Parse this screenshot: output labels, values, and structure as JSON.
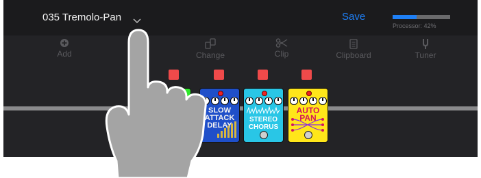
{
  "header": {
    "preset_name": "035 Tremolo-Pan",
    "save_label": "Save",
    "processor_label": "Processor: 42%",
    "processor_fraction": 0.42,
    "accent": "#1e7ff5"
  },
  "toolbar": {
    "items": [
      {
        "label": "Add",
        "icon": "plus-circle-icon"
      },
      {
        "label": "",
        "icon": "obscured-tool-icon"
      },
      {
        "label": "Change",
        "icon": "swap-icon"
      },
      {
        "label": "Clip",
        "icon": "scissors-icon"
      },
      {
        "label": "Clipboard",
        "icon": "clipboard-icon"
      },
      {
        "label": "Tuner",
        "icon": "tuning-fork-icon"
      }
    ]
  },
  "pedals": [
    {
      "name": "green-pedal",
      "title": "",
      "color": "#2ee82a"
    },
    {
      "name": "slow-attack-delay",
      "title": "SLOW ATTACK DELAY",
      "color": "#1f4fc9"
    },
    {
      "name": "stereo-chorus",
      "title": "STEREO CHORUS",
      "color": "#29c6e6"
    },
    {
      "name": "auto-pan",
      "title": "AUTO PAN",
      "color": "#ffe61a"
    }
  ],
  "overlay": {
    "icon": "pointing-hand-icon"
  }
}
